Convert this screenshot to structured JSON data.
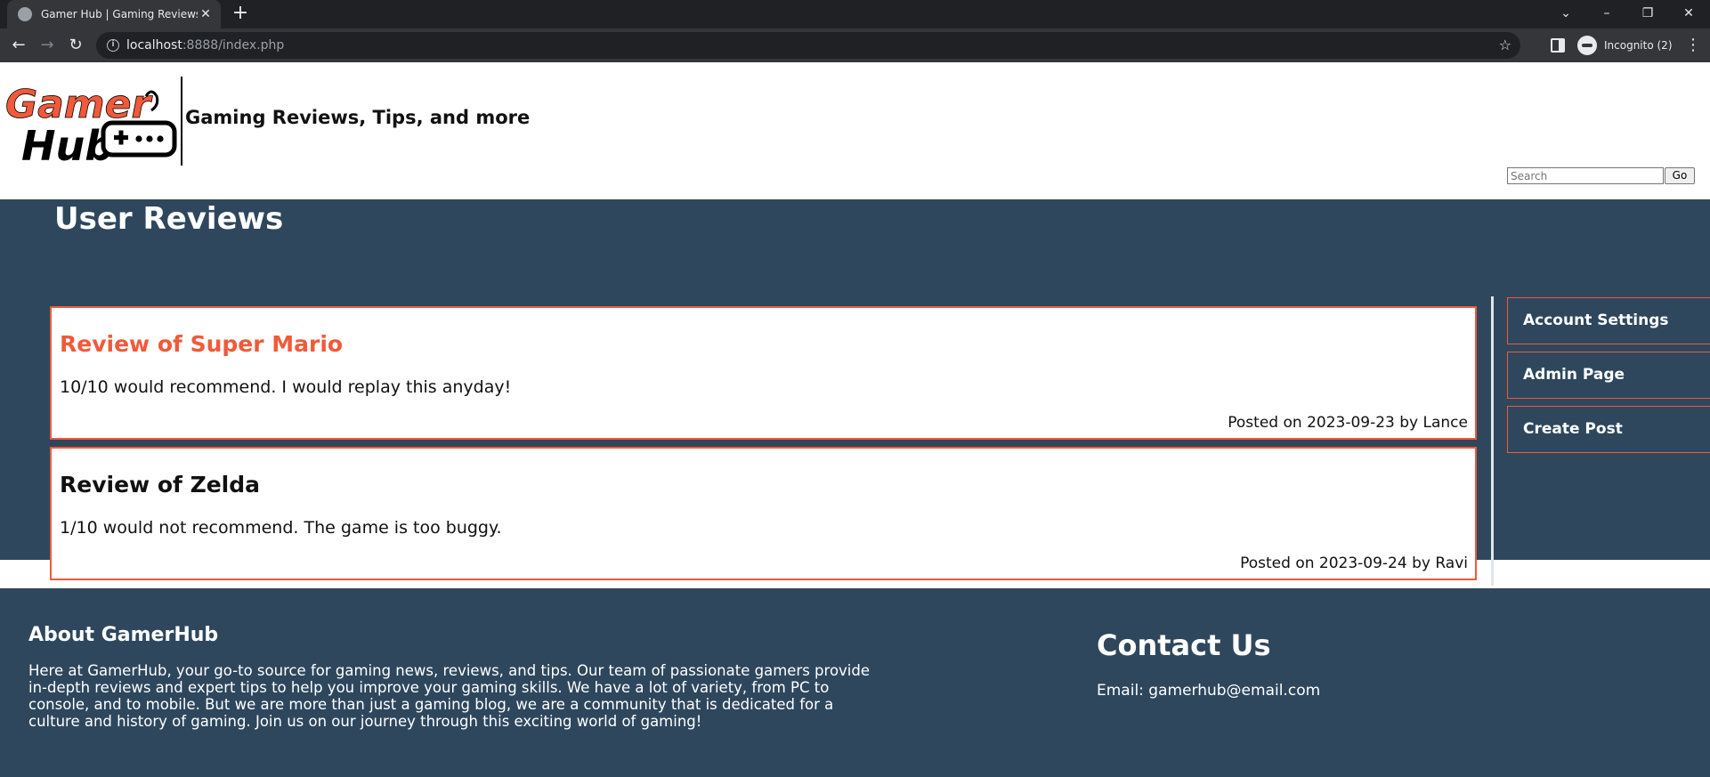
{
  "browser": {
    "tab_title": "Gamer Hub | Gaming Reviews, Tips, and more",
    "url_host": "localhost",
    "url_rest": ":8888/index.php",
    "profile_label": "Incognito (2)"
  },
  "header": {
    "logo_line1": "Gamer",
    "logo_line2": "Hub",
    "tagline": "Gaming Reviews, Tips, and more",
    "search_placeholder": "Search",
    "search_button": "Go"
  },
  "main": {
    "title": "User Reviews",
    "posts": [
      {
        "title": "Review of Super Mario",
        "body": "10/10 would recommend. I would replay this anyday!",
        "meta": "Posted on 2023-09-23 by Lance",
        "title_color": "#f05a3a"
      },
      {
        "title": "Review of Zelda",
        "body": "1/10 would not recommend. The game is too buggy.",
        "meta": "Posted on 2023-09-24 by Ravi",
        "title_color": "#111111"
      }
    ]
  },
  "sidebar": {
    "links": [
      "Account Settings",
      "Admin Page",
      "Create Post"
    ]
  },
  "footer": {
    "about_title": "About GamerHub",
    "about_text": "Here at GamerHub, your go-to source for gaming news, reviews, and tips. Our team of passionate gamers provide in-depth reviews and expert tips to help you improve your gaming skills. We have a lot of variety, from PC to console, and to mobile. But we are more than just a gaming blog, we are a community that is dedicated for a culture and history of gaming. Join us on our journey through this exciting world of gaming!",
    "contact_title": "Contact Us",
    "contact_email": "Email: gamerhub@email.com"
  },
  "colors": {
    "accent": "#f05a3a",
    "band": "#2e475d"
  }
}
